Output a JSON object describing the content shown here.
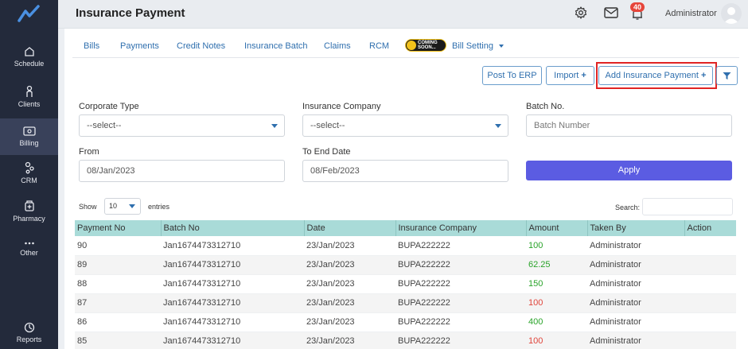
{
  "app": {
    "page_title": "Insurance Payment",
    "user_name": "Administrator",
    "notification_count": "40"
  },
  "sidebar": {
    "items": [
      {
        "label": "Schedule",
        "icon": "home-icon"
      },
      {
        "label": "Clients",
        "icon": "person-icon"
      },
      {
        "label": "Billing",
        "icon": "billing-icon",
        "active": true
      },
      {
        "label": "CRM",
        "icon": "crm-icon"
      },
      {
        "label": "Pharmacy",
        "icon": "pharmacy-icon"
      },
      {
        "label": "Other",
        "icon": "more-icon"
      },
      {
        "label": "Reports",
        "icon": "reports-icon"
      }
    ]
  },
  "tabs": [
    "Bills",
    "Payments",
    "Credit Notes",
    "Insurance Batch",
    "Claims",
    "RCM",
    "Bill Setting"
  ],
  "coming_soon": "COMING SOON...",
  "actions": {
    "post_erp": "Post To ERP",
    "import": "Import",
    "add_payment": "Add Insurance Payment"
  },
  "filters": {
    "corporate_type_label": "Corporate Type",
    "corporate_type_value": "--select--",
    "insurance_company_label": "Insurance Company",
    "insurance_company_value": "--select--",
    "batch_no_label": "Batch No.",
    "batch_no_placeholder": "Batch Number",
    "from_label": "From",
    "from_value": "08/Jan/2023",
    "to_label": "To End Date",
    "to_value": "08/Feb/2023",
    "apply": "Apply"
  },
  "table_controls": {
    "show": "Show",
    "entries_value": "10",
    "entries": "entries",
    "search": "Search:"
  },
  "table": {
    "columns": [
      "Payment No",
      "Batch No",
      "Date",
      "Insurance Company",
      "Amount",
      "Taken By",
      "Action"
    ],
    "rows": [
      {
        "payment_no": "90",
        "batch_no": "Jan1674473312710",
        "date": "23/Jan/2023",
        "company": "BUPA222222",
        "amount": "100",
        "taken_by": "Administrator"
      },
      {
        "payment_no": "89",
        "batch_no": "Jan1674473312710",
        "date": "23/Jan/2023",
        "company": "BUPA222222",
        "amount": "62.25",
        "taken_by": "Administrator"
      },
      {
        "payment_no": "88",
        "batch_no": "Jan1674473312710",
        "date": "23/Jan/2023",
        "company": "BUPA222222",
        "amount": "150",
        "taken_by": "Administrator"
      },
      {
        "payment_no": "87",
        "batch_no": "Jan1674473312710",
        "date": "23/Jan/2023",
        "company": "BUPA222222",
        "amount": "100",
        "taken_by": "Administrator"
      },
      {
        "payment_no": "86",
        "batch_no": "Jan1674473312710",
        "date": "23/Jan/2023",
        "company": "BUPA222222",
        "amount": "400",
        "taken_by": "Administrator"
      },
      {
        "payment_no": "85",
        "batch_no": "Jan1674473312710",
        "date": "23/Jan/2023",
        "company": "BUPA222222",
        "amount": "100",
        "taken_by": "Administrator"
      }
    ]
  },
  "colors": {
    "sidebar": "#232a3b",
    "accent": "#5b5ce2",
    "link": "#2f6fae",
    "table_header": "#a9dbd8",
    "amount_green": "#29a329",
    "amount_red": "#e0443a",
    "highlight": "#e02424"
  }
}
